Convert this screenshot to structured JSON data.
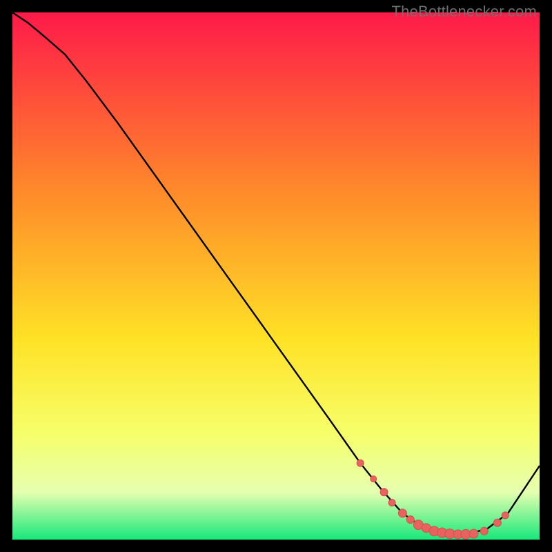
{
  "attribution": "TheBottlenecker.com",
  "colors": {
    "gradient_top": "#ff1a49",
    "gradient_mid1": "#ff8a2a",
    "gradient_mid2": "#ffe226",
    "gradient_low": "#f6ff6a",
    "gradient_pale": "#e6ffb0",
    "gradient_bottom": "#17e87a",
    "curve": "#000000",
    "marker_fill": "#e8635f",
    "marker_stroke": "#d54f4c",
    "frame": "#000000"
  },
  "chart_data": {
    "type": "line",
    "title": "",
    "xlabel": "",
    "ylabel": "",
    "xlim": [
      0,
      100
    ],
    "ylim": [
      0,
      100
    ],
    "grid": false,
    "legend": false,
    "series": [
      {
        "name": "bottleneck-curve",
        "x": [
          0,
          3,
          6,
          10,
          14,
          20,
          30,
          40,
          50,
          60,
          66,
          70,
          74,
          78,
          82,
          86,
          90,
          94,
          100
        ],
        "y": [
          100,
          98,
          95.5,
          92,
          87,
          79,
          65,
          51,
          37,
          23,
          14.5,
          9.5,
          5,
          2.2,
          1,
          1,
          2,
          5,
          14
        ]
      }
    ],
    "markers": {
      "name": "critical-zone-dots",
      "x": [
        66,
        68.5,
        70.5,
        72,
        74,
        75.5,
        77,
        78.5,
        80,
        81.5,
        83,
        84.5,
        86,
        87.5,
        89.5,
        92,
        93.5
      ],
      "y": [
        14.5,
        11.5,
        9,
        7,
        5,
        3.8,
        2.8,
        2.2,
        1.6,
        1.3,
        1.1,
        1,
        1,
        1.1,
        1.6,
        3.2,
        4.6
      ],
      "r": [
        5,
        4.5,
        5.5,
        5,
        6,
        5.5,
        7,
        6.5,
        7,
        7,
        7,
        6.5,
        7,
        6.5,
        5.5,
        5.5,
        5
      ]
    }
  }
}
